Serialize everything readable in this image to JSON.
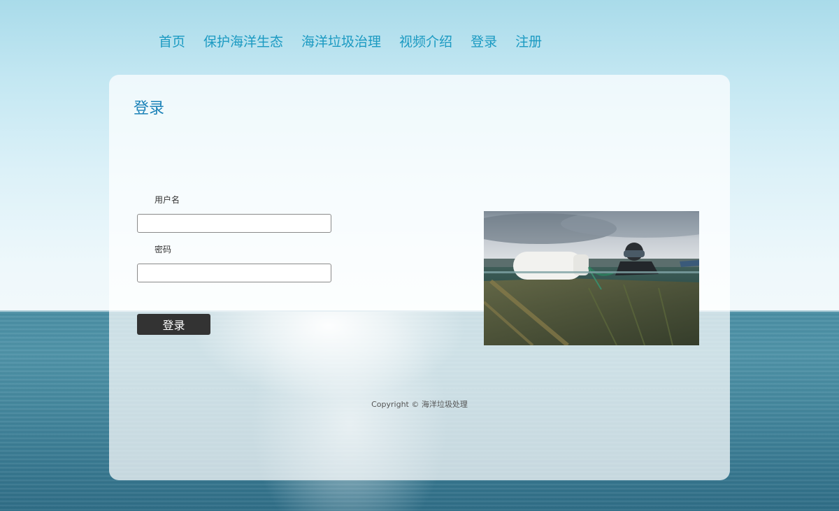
{
  "nav": {
    "items": [
      {
        "label": "首页"
      },
      {
        "label": "保护海洋生态"
      },
      {
        "label": "海洋垃圾治理"
      },
      {
        "label": "视频介绍"
      },
      {
        "label": "登录"
      },
      {
        "label": "注册"
      }
    ],
    "color": "#1b9ac2"
  },
  "login": {
    "title": "登录",
    "username_label": "用户名",
    "username_value": "",
    "password_label": "密码",
    "password_value": "",
    "submit_label": "登录",
    "title_color": "#1b82b8",
    "button_color": "#333333"
  },
  "footer": {
    "copyright": "Copyright © 海洋垃圾处理"
  }
}
